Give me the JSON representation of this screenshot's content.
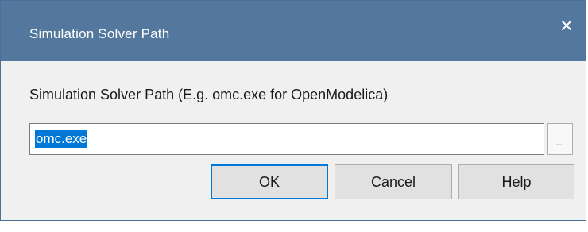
{
  "dialog": {
    "title": "Simulation Solver Path",
    "prompt": "Simulation Solver Path (E.g. omc.exe for OpenModelica)",
    "path_value": "omc.exe",
    "browse_label": "...",
    "buttons": {
      "ok": "OK",
      "cancel": "Cancel",
      "help": "Help"
    }
  },
  "colors": {
    "titlebar": "#54779e",
    "selection": "#0078d7"
  },
  "icons": {
    "close": "close-icon"
  }
}
